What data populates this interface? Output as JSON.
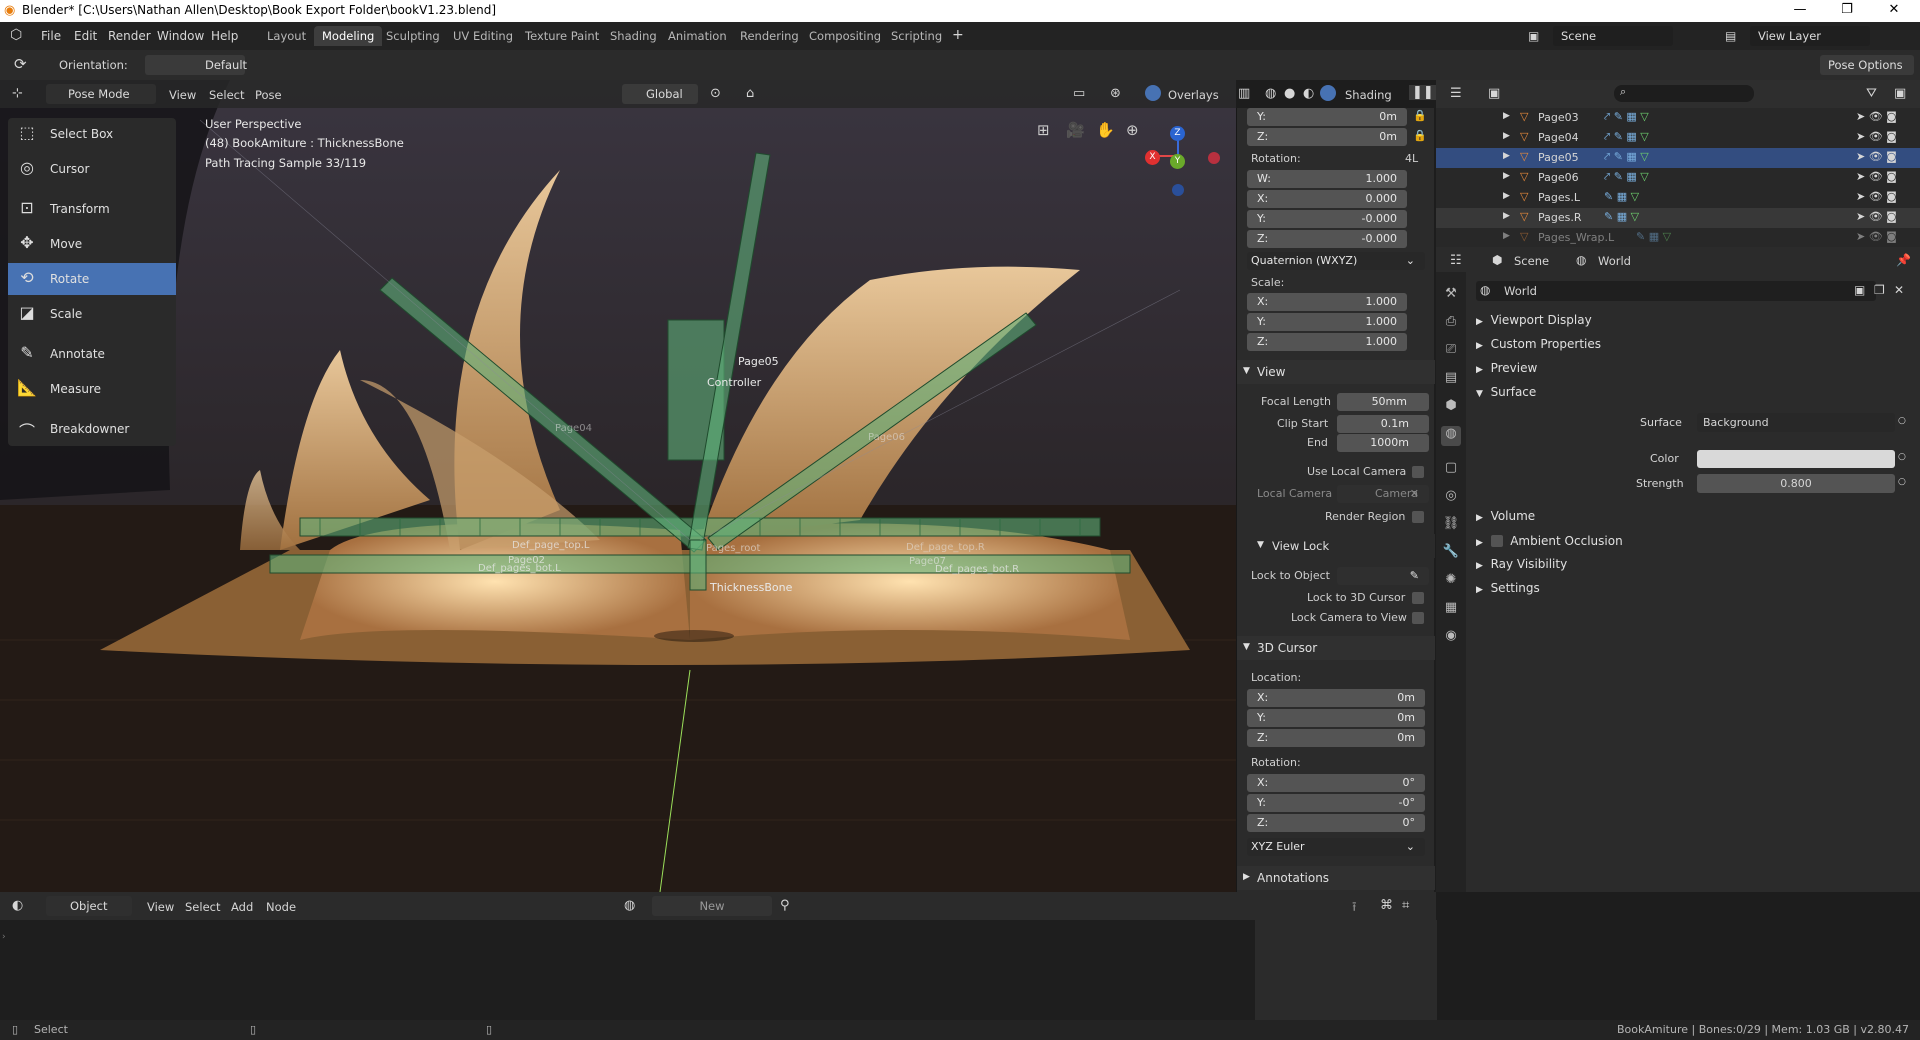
{
  "window": {
    "title": "Blender* [C:\\Users\\Nathan Allen\\Desktop\\Book Export Folder\\bookV1.23.blend]"
  },
  "menus": [
    "File",
    "Edit",
    "Render",
    "Window",
    "Help"
  ],
  "workspaces": [
    "Layout",
    "Modeling",
    "Sculpting",
    "UV Editing",
    "Texture Paint",
    "Shading",
    "Animation",
    "Rendering",
    "Compositing",
    "Scripting"
  ],
  "active_workspace": "Modeling",
  "scene": "Scene",
  "view_layer": "View Layer",
  "toolheader": {
    "orientation_label": "Orientation:",
    "orientation_value": "Default",
    "pose_options": "Pose Options"
  },
  "viewport_header": {
    "mode": "Pose Mode",
    "menus": [
      "View",
      "Select",
      "Pose"
    ],
    "transform": "Global",
    "overlays": "Overlays",
    "shading": "Shading"
  },
  "tools": [
    "Select Box",
    "Cursor",
    "Transform",
    "Move",
    "Rotate",
    "Scale",
    "Annotate",
    "Measure",
    "Breakdowner"
  ],
  "active_tool": "Rotate",
  "viewport_info": {
    "perspective": "User Perspective",
    "object": "(48) BookAmiture : ThicknessBone",
    "samples": "Path Tracing Sample 33/119"
  },
  "bone_labels": {
    "page05": "Page05",
    "controller": "Controller",
    "page04": "Page04",
    "page06": "Page06",
    "def_top_l": "Def_page_top.L",
    "def_top_r": "Def_page_top.R",
    "page02": "Page02",
    "def_bot_l": "Def_pages_bot.L",
    "def_bot_r": "Def_pages_bot.R",
    "page07": "Page07",
    "pages_root": "Pages_root",
    "thickness": "ThicknessBone"
  },
  "gizmo": {
    "x": "X",
    "y": "Y",
    "z": "Z"
  },
  "npanel": {
    "loc_y": {
      "k": "Y:",
      "v": "0m"
    },
    "loc_z": {
      "k": "Z:",
      "v": "0m"
    },
    "rotation_label": "Rotation:",
    "rot_mode_short": "4L",
    "rot_w": {
      "k": "W:",
      "v": "1.000"
    },
    "rot_x": {
      "k": "X:",
      "v": "0.000"
    },
    "rot_y": {
      "k": "Y:",
      "v": "-0.000"
    },
    "rot_z": {
      "k": "Z:",
      "v": "-0.000"
    },
    "rot_mode": "Quaternion (WXYZ)",
    "scale_label": "Scale:",
    "sc_x": {
      "k": "X:",
      "v": "1.000"
    },
    "sc_y": {
      "k": "Y:",
      "v": "1.000"
    },
    "sc_z": {
      "k": "Z:",
      "v": "1.000"
    },
    "view_section": "View",
    "focal_length_label": "Focal Length",
    "focal_length": "50mm",
    "clip_start_label": "Clip Start",
    "clip_start": "0.1m",
    "clip_end_label": "End",
    "clip_end": "1000m",
    "use_local_camera": "Use Local Camera",
    "local_camera_label": "Local Camera",
    "local_camera_value": "Camera",
    "render_region": "Render Region",
    "view_lock": "View Lock",
    "lock_to_object": "Lock to Object",
    "lock_3d_cursor": "Lock to 3D Cursor",
    "lock_camera": "Lock Camera to View",
    "cursor_section": "3D Cursor",
    "location_label": "Location:",
    "cur_x": {
      "k": "X:",
      "v": "0m"
    },
    "cur_y": {
      "k": "Y:",
      "v": "0m"
    },
    "cur_z": {
      "k": "Z:",
      "v": "0m"
    },
    "cur_rot_label": "Rotation:",
    "cr_x": {
      "k": "X:",
      "v": "0°"
    },
    "cr_y": {
      "k": "Y:",
      "v": "-0°"
    },
    "cr_z": {
      "k": "Z:",
      "v": "0°"
    },
    "euler": "XYZ Euler",
    "annotations": "Annotations"
  },
  "outliner": {
    "rows": [
      "Page03",
      "Page04",
      "Page05",
      "Page06",
      "Pages.L",
      "Pages.R",
      "Pages_Wrap.L"
    ],
    "selected": "Page05"
  },
  "properties": {
    "breadcrumb_scene": "Scene",
    "breadcrumb_world": "World",
    "world_name": "World",
    "sections": [
      "Viewport Display",
      "Custom Properties",
      "Preview",
      "Surface"
    ],
    "surface_label": "Surface",
    "surface_value": "Background",
    "color_label": "Color",
    "strength_label": "Strength",
    "strength_value": "0.800",
    "sections2": [
      "Volume",
      "Ambient Occlusion",
      "Ray Visibility",
      "Settings"
    ],
    "world_color": "#d9d9d9"
  },
  "node_header": {
    "mode": "Object",
    "menus": [
      "View",
      "Select",
      "Add",
      "Node"
    ],
    "new": "New"
  },
  "status": {
    "left": "Select",
    "right": "BookAmiture | Bones:0/29 | Mem: 1.03 GB | v2.80.47"
  }
}
